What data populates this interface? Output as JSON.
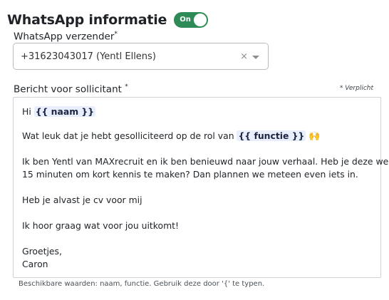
{
  "section": {
    "title": "WhatsApp informatie",
    "toggle_label": "On"
  },
  "sender": {
    "label": "WhatsApp verzender",
    "required_mark": "*",
    "value": "+31623043017 (Yentl Ellens)",
    "clear_symbol": "×"
  },
  "message": {
    "label": "Bericht voor sollicitant",
    "required_mark": "*",
    "required_note": "* Verplicht",
    "lines": {
      "greeting_prefix": "Hi ",
      "var_naam": "{{ naam }}",
      "intro_prefix": "Wat leuk dat je hebt gesolliciteerd op de rol van ",
      "var_functie": "{{ functie }}",
      "emoji": "🙌",
      "para1_line1": "Ik ben Yentl van MAXrecruit en ik ben benieuwd naar jouw verhaal. Heb je deze week",
      "para1_line2": "15 minuten om kort kennis te maken? Dan plannen we meteen even iets in.",
      "para2": "Heb je alvast je cv voor mij",
      "para3": "Ik hoor graag wat voor jou uitkomt!",
      "closing": "Groetjes,",
      "signature": "Caron"
    }
  },
  "hint": "Beschikbare waarden: naam, functie. Gebruik deze door '{' te typen.",
  "colors": {
    "toggle_on": "#2e8b57",
    "variable_highlight": "#e8eefc"
  },
  "icons": {
    "clear": "clear-icon",
    "dropdown": "chevron-down-icon"
  }
}
